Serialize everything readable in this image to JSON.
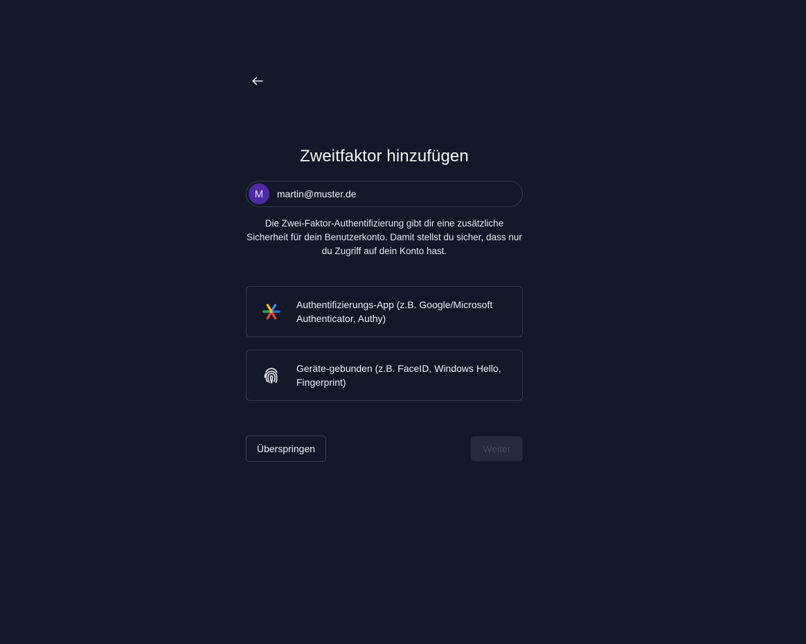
{
  "page": {
    "title": "Zweitfaktor hinzufügen",
    "back_icon": "arrow-left-icon"
  },
  "account": {
    "avatar_initial": "M",
    "avatar_color": "#4e2aa6",
    "email": "martin@muster.de"
  },
  "description": "Die Zwei-Faktor-Authentifizierung gibt dir eine zusätzliche Sicherheit für dein Benutzerkonto. Damit stellst du sicher, dass nur du Zugriff auf dein Konto hast.",
  "options": [
    {
      "icon": "authenticator-app-icon",
      "label": "Authentifizierungs-App (z.B. Google/Microsoft Authenticator, Authy)"
    },
    {
      "icon": "fingerprint-icon",
      "label": "Geräte-gebunden (z.B. FaceID, Windows Hello, Fingerprint)"
    }
  ],
  "actions": {
    "skip_label": "Überspringen",
    "next_label": "Weiter",
    "next_disabled": true
  },
  "colors": {
    "background": "#121828",
    "border": "#353c4d",
    "disabled_button": "#252b3a"
  }
}
